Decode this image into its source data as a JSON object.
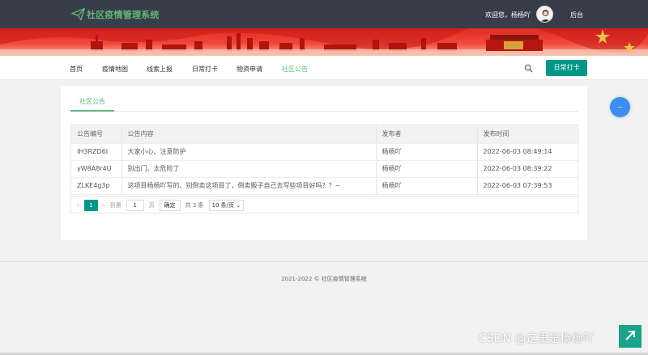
{
  "header": {
    "app_title": "社区疫情管理系统",
    "welcome": "欢迎您，杨杨吖",
    "backend_link": "后台"
  },
  "nav": {
    "items": [
      {
        "label": "首页",
        "active": false
      },
      {
        "label": "疫情地图",
        "active": false
      },
      {
        "label": "线索上报",
        "active": false
      },
      {
        "label": "日常打卡",
        "active": false
      },
      {
        "label": "物资申请",
        "active": false
      },
      {
        "label": "社区公告",
        "active": true
      }
    ],
    "checkin_button": "日常打卡"
  },
  "notice": {
    "tab_label": "社区公告",
    "columns": [
      "公告编号",
      "公告内容",
      "发布者",
      "发布时间"
    ],
    "rows": [
      [
        "IH3RZD6I",
        "大家小心、注意防护",
        "杨杨吖",
        "2022-06-03 08:49:14"
      ],
      [
        "yW8A8r4U",
        "别出门、太危险了",
        "杨杨吖",
        "2022-06-03 08:39:22"
      ],
      [
        "ZLKE4g3p",
        "这项目杨杨吖写的、别倒卖这项目了，倒卖贩子自己去写些项目好吗？？~",
        "杨杨吖",
        "2022-06-03 07:39:53"
      ]
    ]
  },
  "pagination": {
    "current_page": "1",
    "goto_label": "到第",
    "goto_value": "1",
    "page_unit": "页",
    "confirm": "确定",
    "total": "共 3 条",
    "page_size": "10 条/页"
  },
  "footer": {
    "copyright": "2021-2022 © 社区疫情管理系统"
  },
  "watermark": "CSDN @这里是杨杨吖",
  "colors": {
    "topbar": "#393d49",
    "accent_green": "#5fb878",
    "primary_teal": "#009688",
    "banner_red": "#e02a22"
  }
}
